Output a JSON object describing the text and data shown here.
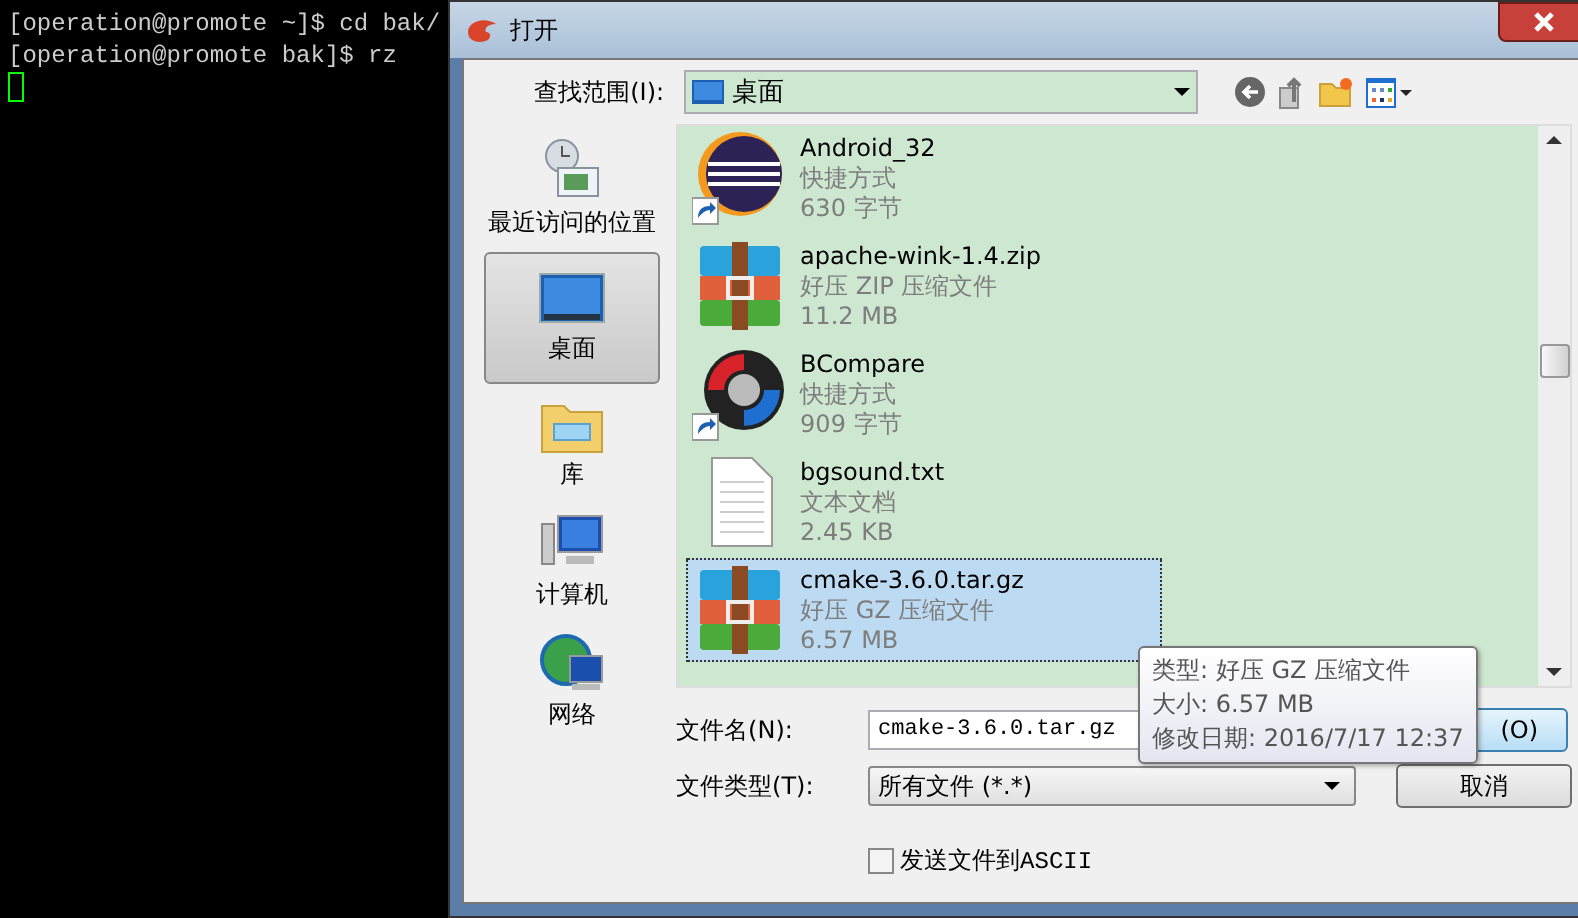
{
  "terminal": {
    "lines": [
      "[operation@promote ~]$ cd bak/",
      "[operation@promote bak]$ rz"
    ]
  },
  "dialog": {
    "title": "打开",
    "look_in": {
      "label": "查找范围(I):",
      "value": "桌面"
    },
    "places": [
      {
        "label": "最近访问的位置",
        "kind": "recent",
        "selected": false
      },
      {
        "label": "桌面",
        "kind": "desktop",
        "selected": true
      },
      {
        "label": "库",
        "kind": "library",
        "selected": false
      },
      {
        "label": "计算机",
        "kind": "computer",
        "selected": false
      },
      {
        "label": "网络",
        "kind": "network",
        "selected": false
      }
    ],
    "files": [
      {
        "name": "Android_32",
        "type": "快捷方式",
        "size": "630 字节",
        "kind": "eclipse",
        "selected": false
      },
      {
        "name": "apache-wink-1.4.zip",
        "type": "好压 ZIP 压缩文件",
        "size": "11.2 MB",
        "kind": "archive",
        "selected": false
      },
      {
        "name": "BCompare",
        "type": "快捷方式",
        "size": "909 字节",
        "kind": "compare",
        "selected": false
      },
      {
        "name": "bgsound.txt",
        "type": "文本文档",
        "size": "2.45 KB",
        "kind": "text",
        "selected": false
      },
      {
        "name": "cmake-3.6.0.tar.gz",
        "type": "好压 GZ 压缩文件",
        "size": "6.57 MB",
        "kind": "archive",
        "selected": true
      }
    ],
    "tooltip": [
      "类型: 好压 GZ 压缩文件",
      "大小: 6.57 MB",
      "修改日期: 2016/7/17 12:37"
    ],
    "file_name": {
      "label": "文件名(N):",
      "value": "cmake-3.6.0.tar.gz"
    },
    "file_type": {
      "label": "文件类型(T):",
      "value": "所有文件 (*.*)"
    },
    "open_button": "(O)",
    "cancel_button": "取消",
    "ascii_checkbox": {
      "label": "发送文件到ASCII",
      "checked": false
    }
  }
}
